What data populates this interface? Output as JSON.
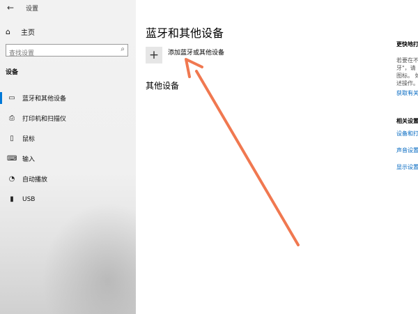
{
  "window": {
    "title": "设置",
    "back_icon": "back-arrow-icon"
  },
  "sidebar": {
    "home_label": "主页",
    "search_placeholder": "查找设置",
    "section_heading": "设备",
    "items": [
      {
        "label": "蓝牙和其他设备",
        "icon": "bluetooth-icon",
        "active": true
      },
      {
        "label": "打印机和扫描仪",
        "icon": "printer-icon"
      },
      {
        "label": "鼠标",
        "icon": "mouse-icon"
      },
      {
        "label": "输入",
        "icon": "keyboard-icon"
      },
      {
        "label": "自动播放",
        "icon": "autoplay-icon"
      },
      {
        "label": "USB",
        "icon": "usb-icon"
      }
    ]
  },
  "main": {
    "page_title": "蓝牙和其他设备",
    "add_device_label": "添加蓝牙或其他设备",
    "other_devices_heading": "其他设备"
  },
  "right_panel": {
    "quick_heading": "更快地打",
    "quick_lines": [
      "若要在不",
      "牙\"，请",
      "图标。 如",
      "述操作。"
    ],
    "quick_link": "获取有关",
    "related_heading": "相关设置",
    "related_links": [
      "设备和打",
      "声音设置",
      "显示设置"
    ]
  },
  "annotation": {
    "color": "#f07850"
  }
}
